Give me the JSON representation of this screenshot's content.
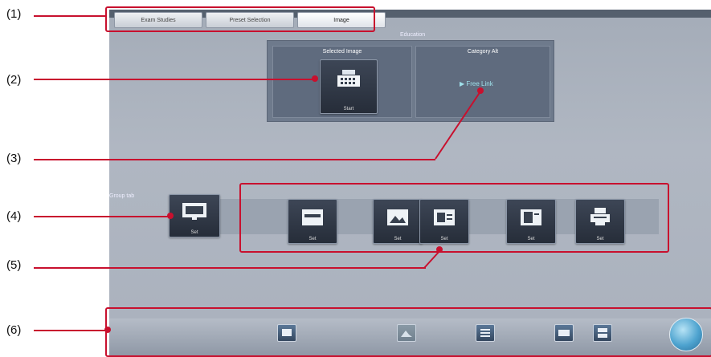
{
  "callouts": [
    "(1)",
    "(2)",
    "(3)",
    "(4)",
    "(5)",
    "(6)"
  ],
  "tabs": [
    {
      "label": "Exam Studies",
      "active": false
    },
    {
      "label": "Preset Selection",
      "active": false
    },
    {
      "label": "Image",
      "active": true
    }
  ],
  "panel": {
    "title": "Education",
    "left_header": "Selected Image",
    "left_tile_caption": "Start",
    "right_header": "Category Alt",
    "link_label": "Free Link"
  },
  "strip": {
    "label": "Group tab",
    "first_tile_caption": "Set",
    "tiles": [
      {
        "caption": "Set",
        "icon": "image-icon"
      },
      {
        "caption": "Set",
        "icon": "picture-icon"
      },
      {
        "caption": "Set",
        "icon": "chart-icon"
      },
      {
        "caption": "Set",
        "icon": "sheet-icon"
      },
      {
        "caption": "Set",
        "icon": "printer-icon"
      }
    ]
  },
  "bottom_buttons": [
    {
      "name": "bottom-button-1",
      "icon": "image-icon"
    },
    {
      "name": "bottom-button-2",
      "icon": "mountain-icon"
    },
    {
      "name": "bottom-button-3",
      "icon": "list-icon"
    },
    {
      "name": "bottom-button-4",
      "icon": "edit-icon"
    },
    {
      "name": "bottom-button-5",
      "icon": "stack-icon"
    }
  ],
  "colors": {
    "accent": "#c8102e",
    "panel": "#6e7a8c",
    "tile": "#2f3746"
  }
}
